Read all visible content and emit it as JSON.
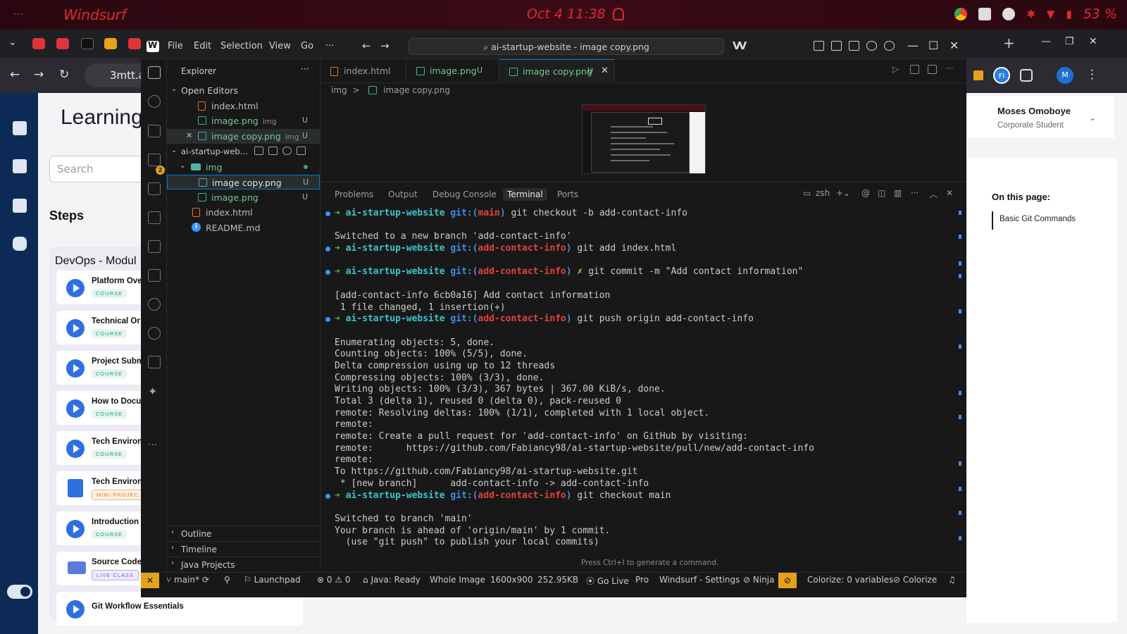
{
  "topbar": {
    "dots": "⋯",
    "app_name": "Windsurf",
    "clock": "Oct 4  11:38",
    "battery": "53 %"
  },
  "browser": {
    "url_prefix": "3mtt.a"
  },
  "learning": {
    "title": "Learning",
    "search_placeholder": "Search",
    "steps_label": "Steps",
    "module_title": "DevOps - Modul",
    "items": [
      {
        "title": "Platform Ove",
        "badge": "COURSE"
      },
      {
        "title": "Technical Or",
        "badge": "COURSE"
      },
      {
        "title": "Project Subm",
        "badge": "COURSE"
      },
      {
        "title": "How to Docu",
        "badge": "COURSE"
      },
      {
        "title": "Tech Environ",
        "badge": "COURSE"
      },
      {
        "title": "Tech Environ",
        "badge": "MINI-PROJEC"
      },
      {
        "title": "Introduction",
        "badge": "COURSE"
      },
      {
        "title": "Source Code",
        "badge": "LIVE CLASS"
      },
      {
        "title": "Git Workflow Essentials",
        "badge": ""
      }
    ],
    "user_name": "Moses Omoboye",
    "user_role": "Corporate Student",
    "on_this_page": "On this page:",
    "otp_item": "Basic Git Commands",
    "ext_initials": "FI",
    "profile_initial": "M"
  },
  "ide": {
    "menu": [
      "File",
      "Edit",
      "Selection",
      "View",
      "Go",
      "···"
    ],
    "search_text": "ai-startup-website - image copy.png",
    "explorer_title": "Explorer",
    "open_editors_label": "Open Editors",
    "open_editors": [
      {
        "name": "index.html",
        "hint": "",
        "badge": ""
      },
      {
        "name": "image.png",
        "hint": "img",
        "badge": "U"
      },
      {
        "name": "image copy.png",
        "hint": "img",
        "badge": "U"
      }
    ],
    "project_label": "ai-startup-web...",
    "folder_img": "img",
    "files": [
      {
        "name": "image copy.png",
        "badge": "U"
      },
      {
        "name": "image.png",
        "badge": "U"
      },
      {
        "name": "index.html",
        "badge": ""
      },
      {
        "name": "README.md",
        "badge": ""
      }
    ],
    "outline_label": "Outline",
    "timeline_label": "Timeline",
    "java_projects_label": "Java Projects",
    "tabs": [
      {
        "name": "index.html",
        "badge": ""
      },
      {
        "name": "image.png",
        "badge": "U"
      },
      {
        "name": "image copy.png",
        "badge": "U"
      }
    ],
    "breadcrumb": {
      "folder": "img",
      "file": "image copy.png",
      "sep": ">"
    },
    "scm_badge": "2",
    "panel_tabs": [
      "Problems",
      "Output",
      "Debug Console",
      "Terminal",
      "Ports"
    ],
    "shell": "zsh",
    "terminal_hint": "Press Ctrl+I to generate a command.",
    "status": {
      "branch": "main*",
      "launchpad": "Launchpad",
      "problems": "⊗ 0 ⚠ 0",
      "java": "Java: Ready",
      "whole_image": "Whole Image",
      "dims": "1600x900",
      "size": "252.95KB",
      "golive": "Go Live",
      "pro": "Pro",
      "settings": "Windsurf - Settings",
      "ninja": "Ninja",
      "colorize_vars": "Colorize: 0 variables",
      "colorize": "Colorize"
    }
  },
  "terminal": {
    "lines": [
      {
        "kind": "prompt",
        "branch": "main",
        "cmd": "git checkout -b add-contact-info",
        "dirty": false
      },
      {
        "kind": "blank"
      },
      {
        "kind": "out",
        "text": "Switched to a new branch 'add-contact-info'"
      },
      {
        "kind": "prompt",
        "branch": "add-contact-info",
        "cmd": "git add index.html",
        "dirty": false
      },
      {
        "kind": "blank"
      },
      {
        "kind": "prompt",
        "branch": "add-contact-info",
        "cmd": "git commit -m \"Add contact information\"",
        "dirty": true
      },
      {
        "kind": "blank"
      },
      {
        "kind": "out",
        "text": "[add-contact-info 6cb0a16] Add contact information"
      },
      {
        "kind": "out",
        "text": " 1 file changed, 1 insertion(+)"
      },
      {
        "kind": "prompt",
        "branch": "add-contact-info",
        "cmd": "git push origin add-contact-info",
        "dirty": false
      },
      {
        "kind": "blank"
      },
      {
        "kind": "out",
        "text": "Enumerating objects: 5, done."
      },
      {
        "kind": "out",
        "text": "Counting objects: 100% (5/5), done."
      },
      {
        "kind": "out",
        "text": "Delta compression using up to 12 threads"
      },
      {
        "kind": "out",
        "text": "Compressing objects: 100% (3/3), done."
      },
      {
        "kind": "out",
        "text": "Writing objects: 100% (3/3), 367 bytes | 367.00 KiB/s, done."
      },
      {
        "kind": "out",
        "text": "Total 3 (delta 1), reused 0 (delta 0), pack-reused 0"
      },
      {
        "kind": "out",
        "text": "remote: Resolving deltas: 100% (1/1), completed with 1 local object."
      },
      {
        "kind": "out",
        "text": "remote:"
      },
      {
        "kind": "out",
        "text": "remote: Create a pull request for 'add-contact-info' on GitHub by visiting:"
      },
      {
        "kind": "out",
        "text": "remote:      https://github.com/Fabiancy98/ai-startup-website/pull/new/add-contact-info"
      },
      {
        "kind": "out",
        "text": "remote:"
      },
      {
        "kind": "out",
        "text": "To https://github.com/Fabiancy98/ai-startup-website.git"
      },
      {
        "kind": "out",
        "text": " * [new branch]      add-contact-info -> add-contact-info"
      },
      {
        "kind": "prompt",
        "branch": "add-contact-info",
        "cmd": "git checkout main",
        "dirty": false
      },
      {
        "kind": "blank"
      },
      {
        "kind": "out",
        "text": "Switched to branch 'main'"
      },
      {
        "kind": "out",
        "text": "Your branch is ahead of 'origin/main' by 1 commit."
      },
      {
        "kind": "out",
        "text": "  (use \"git push\" to publish your local commits)"
      }
    ],
    "repo": "ai-startup-website",
    "arrow": "➜",
    "cross": "✗"
  }
}
